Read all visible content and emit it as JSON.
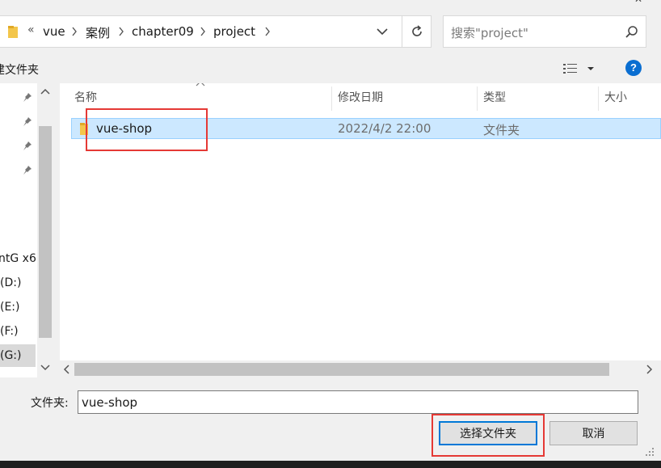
{
  "address_bar": {
    "overflow": "«",
    "crumbs": [
      "vue",
      "案例",
      "chapter09",
      "project"
    ]
  },
  "search": {
    "placeholder": "搜索\"project\""
  },
  "toolbar": {
    "new_folder": "建文件夹",
    "help": "?"
  },
  "nav_pane": {
    "drives": [
      "ntG x6",
      "(D:)",
      "(E:)",
      "(F:)",
      "(G:)"
    ],
    "selected": "(G:)"
  },
  "columns": {
    "name": "名称",
    "modified": "修改日期",
    "type": "类型",
    "size": "大小"
  },
  "rows": [
    {
      "name": "vue-shop",
      "modified": "2022/4/2 22:00",
      "type": "文件夹"
    }
  ],
  "bottom": {
    "folder_label": "文件夹:",
    "folder_value": "vue-shop",
    "select_button": "选择文件夹",
    "cancel_button": "取消"
  },
  "colors": {
    "selection": "#cce8ff",
    "highlight_box": "#e53935",
    "accent": "#0078d7"
  },
  "icons": [
    "folder-icon",
    "chevron-right-icon",
    "chevron-down-icon",
    "refresh-icon",
    "search-icon",
    "view-options-icon",
    "help-icon",
    "pin-icon",
    "scroll-up-icon",
    "scroll-down-icon",
    "scroll-left-icon",
    "scroll-right-icon",
    "sort-ascending-icon",
    "size-grip-icon"
  ]
}
